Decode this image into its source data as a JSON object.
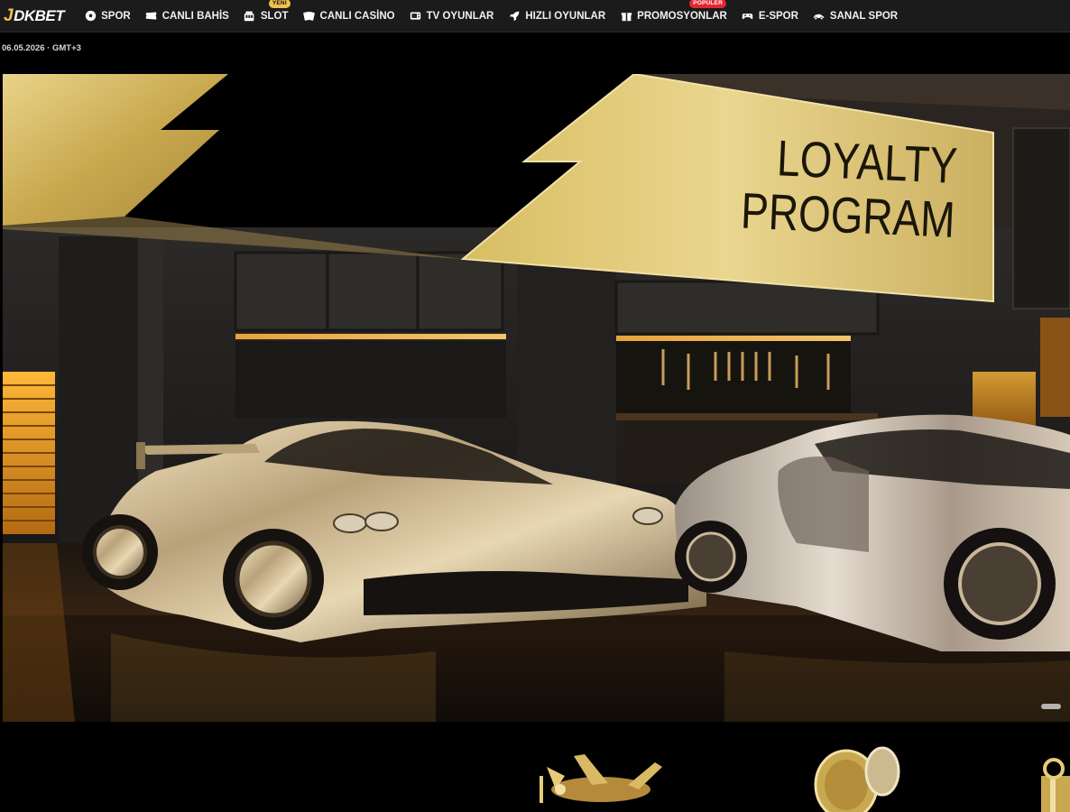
{
  "brand": {
    "logo_text": "DKBET",
    "logo_mark": "J"
  },
  "nav": {
    "items": [
      {
        "label": "SPOR",
        "icon": "soccer-ball-icon"
      },
      {
        "label": "CANLI BAHİS",
        "icon": "ticket-icon"
      },
      {
        "label": "SLOT",
        "icon": "slot-machine-icon",
        "badge": "YENİ"
      },
      {
        "label": "CANLI CASİNO",
        "icon": "cards-icon"
      },
      {
        "label": "TV OYUNLAR",
        "icon": "tv-icon"
      },
      {
        "label": "HIZLI OYUNLAR",
        "icon": "rocket-icon"
      },
      {
        "label": "PROMOSYONLAR",
        "icon": "gift-icon",
        "badge": "POPÜLER"
      },
      {
        "label": "E-SPOR",
        "icon": "gamepad-icon"
      },
      {
        "label": "SANAL SPOR",
        "icon": "racecar-icon"
      }
    ]
  },
  "datebar": {
    "text": "06.05.2026 · GMT+3"
  },
  "hero": {
    "title_line1": "LOYALTY",
    "title_line2": "PROGRAM"
  },
  "colors": {
    "gold": "#c9a94f",
    "gold_light": "#e6cc7a",
    "nav_bg": "#1b1b1b",
    "badge_new": "#f2c14e",
    "badge_popular": "#e5252f"
  }
}
